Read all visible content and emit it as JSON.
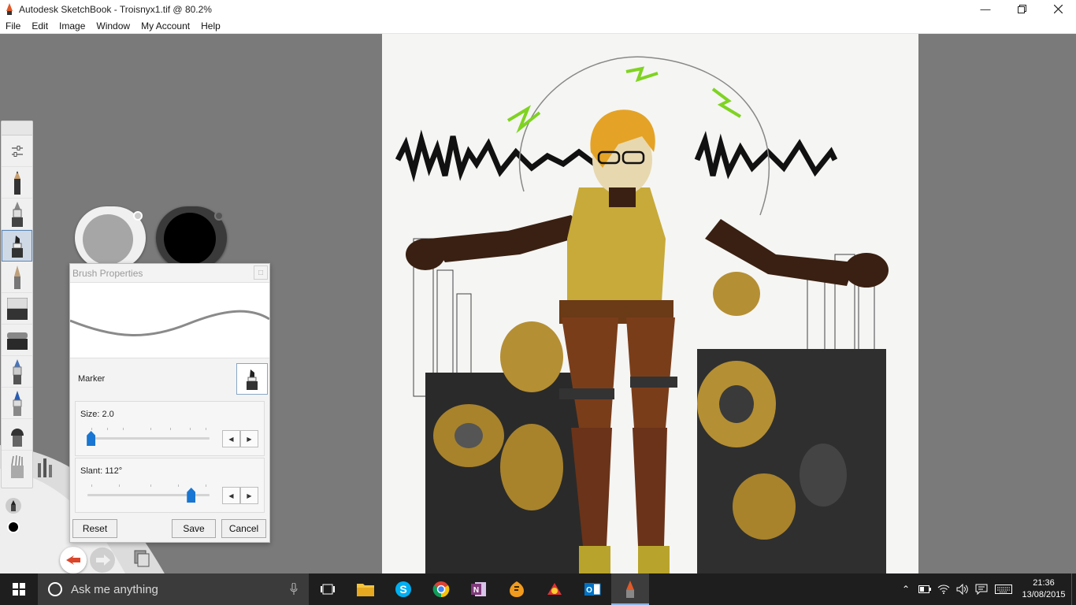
{
  "window": {
    "title": "Autodesk SketchBook - Troisnyx1.tif @ 80.2%",
    "controls": [
      "minimize-icon",
      "maximize-icon",
      "close-icon"
    ]
  },
  "menu": [
    "File",
    "Edit",
    "Image",
    "Window",
    "My Account",
    "Help"
  ],
  "toolbar": {
    "tools": [
      {
        "name": "settings",
        "icon": "sliders-icon"
      },
      {
        "name": "pencil",
        "icon": "pencil-icon"
      },
      {
        "name": "ink-pen",
        "icon": "ink-pen-icon"
      },
      {
        "name": "marker",
        "icon": "marker-icon",
        "selected": true
      },
      {
        "name": "ballpoint",
        "icon": "ballpoint-icon"
      },
      {
        "name": "airbrush",
        "icon": "airbrush-icon"
      },
      {
        "name": "eraser",
        "icon": "eraser-icon"
      },
      {
        "name": "chisel",
        "icon": "chisel-icon"
      },
      {
        "name": "paint-brush",
        "icon": "paint-brush-icon"
      },
      {
        "name": "smear",
        "icon": "smear-brush-icon"
      },
      {
        "name": "wet-brush",
        "icon": "wet-brush-icon"
      }
    ]
  },
  "colors": {
    "secondary": "#a6a6a6",
    "primary": "#000000",
    "accent": "#1976d2"
  },
  "brush_properties": {
    "title": "Brush Properties",
    "brush_name": "Marker",
    "size_label": "Size: 2.0",
    "size_value": 2.0,
    "size_fraction": 0.03,
    "slant_label": "Slant: 112°",
    "slant_value": 112,
    "slant_fraction": 0.85,
    "reset_label": "Reset",
    "save_label": "Save",
    "cancel_label": "Cancel"
  },
  "taskbar": {
    "search_placeholder": "Ask me anything",
    "apps": [
      "task-view-icon",
      "file-explorer-icon",
      "skype-icon",
      "chrome-icon",
      "onenote-icon",
      "fl-studio-icon",
      "app-icon",
      "outlook-icon",
      "sketchbook-icon"
    ],
    "time": "21:36",
    "date": "13/08/2015"
  }
}
